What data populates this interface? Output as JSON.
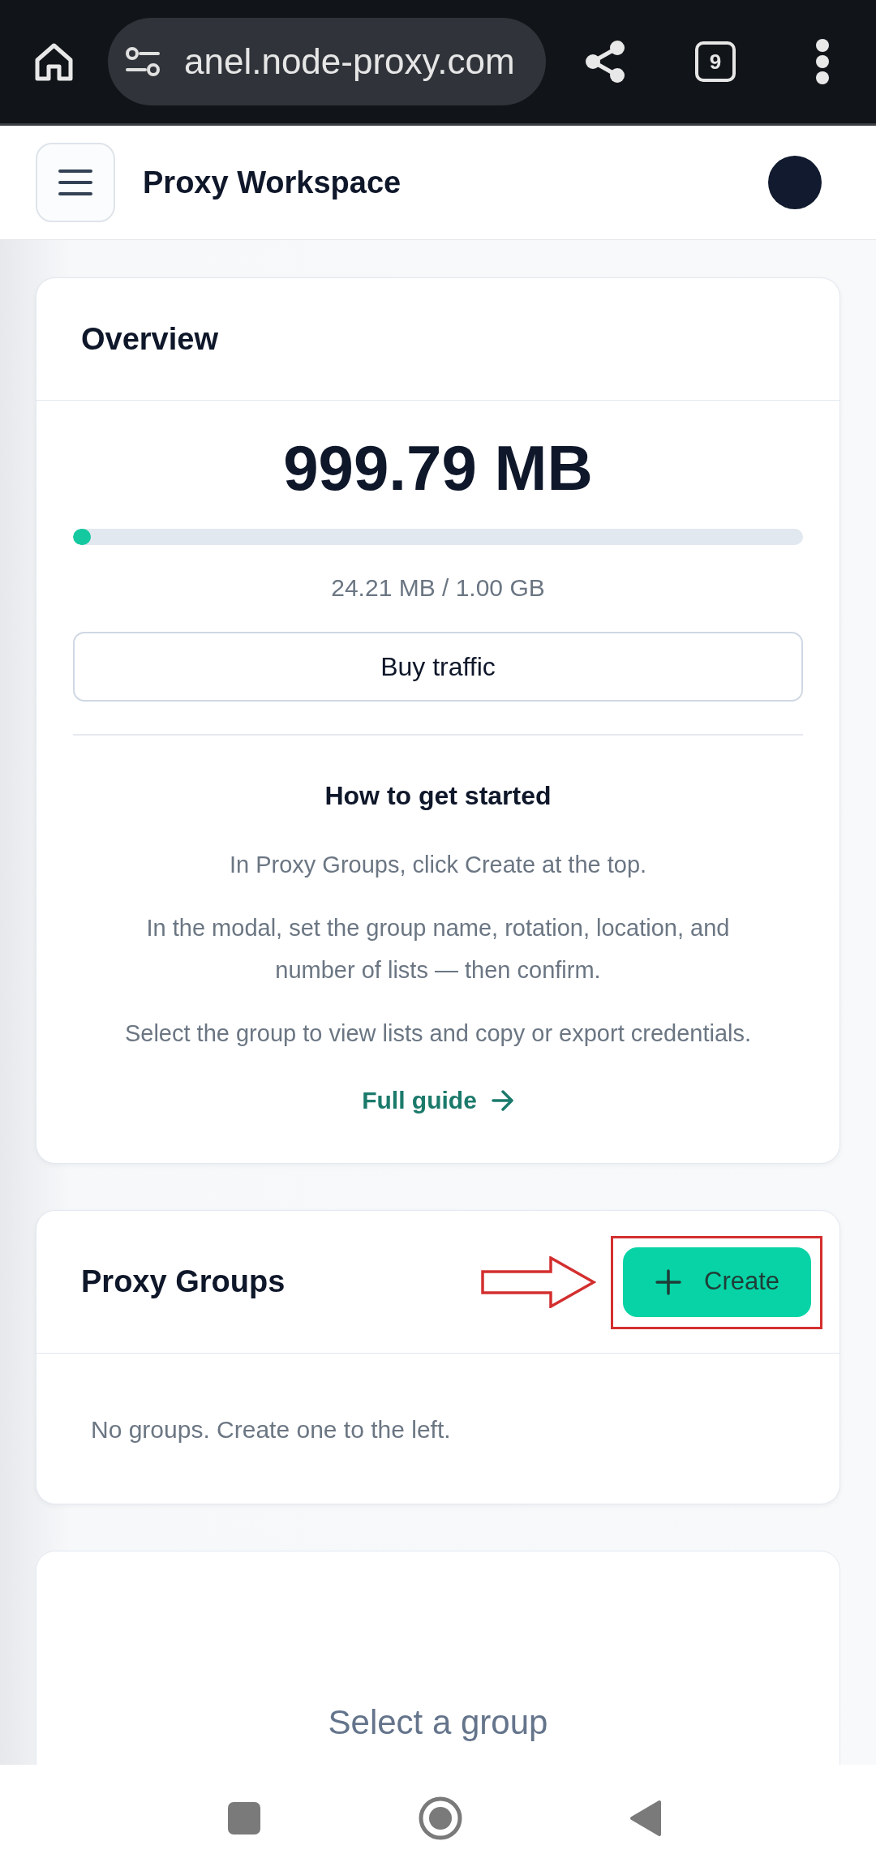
{
  "browser": {
    "url": "anel.node-proxy.com",
    "tab_count": "9"
  },
  "header": {
    "title": "Proxy Workspace"
  },
  "overview": {
    "title": "Overview",
    "balance": "999.79 MB",
    "usage": {
      "level": 0.024
    },
    "usage_text": "24.21 MB / 1.00 GB",
    "buy_button": {
      "label": "Buy traffic"
    },
    "guide": {
      "title": "How to get started",
      "steps": [
        "In Proxy Groups, click Create at the top.",
        "In the modal, set the group name, rotation, location, and number of lists — then confirm.",
        "Select the group to view lists and copy or export credentials."
      ],
      "link": {
        "label": "Full guide"
      }
    }
  },
  "proxy_groups": {
    "title": "Proxy Groups",
    "create_button": {
      "label": "Create",
      "highlighted": true
    },
    "empty_text": "No groups. Create one to the left."
  },
  "details": {
    "empty_text": "Select a group"
  }
}
